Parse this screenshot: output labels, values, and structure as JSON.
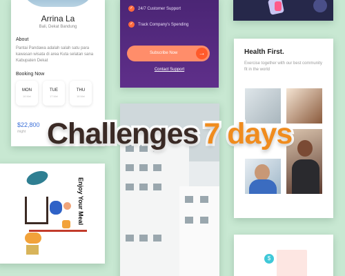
{
  "hotel_card": {
    "name": "Arrina La",
    "location": "Bali, Dekat Bandung",
    "about_heading": "About",
    "about_text": "Pantai Pandawa adalah salah satu para kawasan wisata di area Kuta selatan sana Kabupaten Dekat",
    "booking_heading": "Booking Now",
    "days": [
      {
        "day": "MON",
        "date": "16 Mei"
      },
      {
        "day": "TUE",
        "date": "17 Mei"
      },
      {
        "day": "THU",
        "date": "18 Mei"
      }
    ],
    "price": "$22,800",
    "price_unit": "/night"
  },
  "pricing_card": {
    "features": [
      "24/7 Customer Support",
      "Track Company's Spending"
    ],
    "subscribe_label": "Subscribe Now",
    "contact_label": "Contact Support",
    "accent_color": "#ff6a3d"
  },
  "health_card": {
    "title": "Health First.",
    "description": "Exercise together with our best community fit in the world"
  },
  "meal_card": {
    "vertical_title": "Enjoy Your Meal"
  },
  "headline": {
    "part1": "Challenges",
    "part2": "7 days",
    "part2_color": "#f08c1e"
  }
}
